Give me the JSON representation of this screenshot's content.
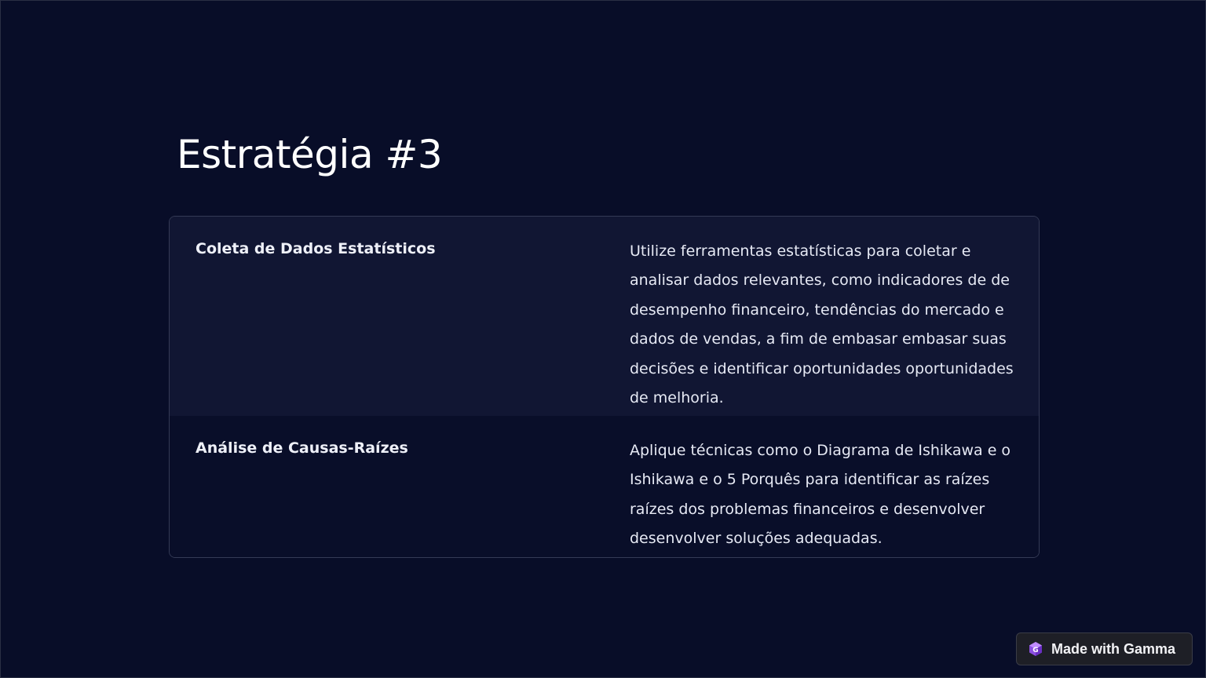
{
  "slide": {
    "title": "Estratégia #3"
  },
  "table": {
    "rows": [
      {
        "label": "Coleta de Dados Estatísticos",
        "description": "Utilize ferramentas estatísticas para coletar e analisar dados relevantes, como indicadores de de desempenho financeiro, tendências do mercado e dados de vendas, a fim de embasar embasar suas decisões e identificar oportunidades oportunidades de melhoria."
      },
      {
        "label": "Análise de Causas-Raízes",
        "description": "Aplique técnicas como o Diagrama de Ishikawa e o Ishikawa e o 5 Porquês para identificar as raízes raízes dos problemas financeiros e desenvolver desenvolver soluções adequadas."
      }
    ]
  },
  "badge": {
    "label": "Made with Gamma",
    "icon": "gamma-logo-icon"
  },
  "colors": {
    "background": "#080d28",
    "row_alt": "#111633",
    "border": "#343a55",
    "badge_bg": "#1e1f26",
    "logo_accent": "#8b4fe0"
  }
}
